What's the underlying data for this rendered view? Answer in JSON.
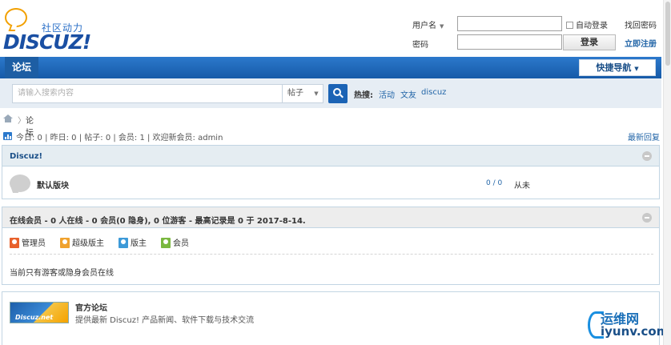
{
  "header": {
    "logo_slogan": "社区动力",
    "logo_text": "DISCUZ!",
    "username_label": "用户名",
    "password_label": "密码",
    "username_value": "",
    "password_value": "",
    "auto_login_label": "自动登录",
    "login_button": "登录",
    "forgot_password": "找回密码",
    "register": "立即注册"
  },
  "nav": {
    "active_tab": "论坛",
    "quick_nav_label": "快捷导航"
  },
  "search": {
    "placeholder": "请输入搜索内容",
    "type_selected": "帖子",
    "hot_label": "热搜:",
    "hot_links": [
      "活动",
      "文友",
      "discuz"
    ]
  },
  "breadcrumb": {
    "separator": "〉",
    "current": "论坛"
  },
  "stats": {
    "text": "今日: 0 | 昨日: 0 | 帖子: 0 | 会员: 1 | 欢迎新会员: admin",
    "newest_reply": "最新回复"
  },
  "category": {
    "title": "Discuz!",
    "forum_name": "默认版块",
    "forum_counts": "0 / 0",
    "forum_last_post": "从未"
  },
  "online": {
    "title": "在线会员 - 0 人在线 - 0 会员(0 隐身), 0 位游客 - 最高记录是 0 于 2017-8-14.",
    "legend": [
      {
        "label": "管理员",
        "color": "#e8612c"
      },
      {
        "label": "超级版主",
        "color": "#f0a22e"
      },
      {
        "label": "版主",
        "color": "#3d9ad8"
      },
      {
        "label": "会员",
        "color": "#7ab840"
      }
    ],
    "note": "当前只有游客或隐身会员在线"
  },
  "links": {
    "logo_text": "Discuz.net",
    "title": "官方论坛",
    "description": "提供最新 Discuz! 产品新闻、软件下载与技术交流"
  },
  "watermark": {
    "cn": "运维网",
    "en": "iyunv.com"
  },
  "colors": {
    "brand_blue": "#2c79cc",
    "link_blue": "#2366a8"
  }
}
